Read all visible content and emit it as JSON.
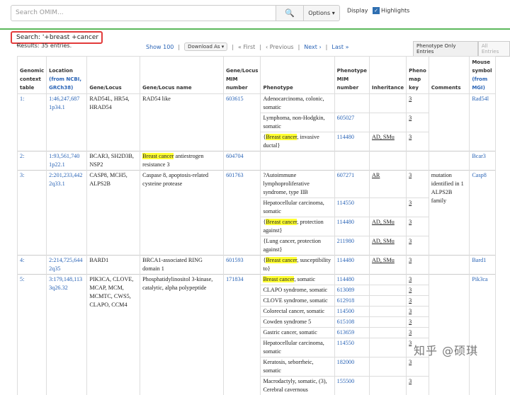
{
  "search": {
    "placeholder": "Search OMIM...",
    "options_label": "Options",
    "display_label": "Display",
    "highlights_label": "Highlights"
  },
  "query": {
    "text": "Search: '+breast +cancer '",
    "results": "Results: 35 entries."
  },
  "pager": {
    "show100": "Show 100",
    "download": "Download As",
    "first": "« First",
    "previous": "‹ Previous",
    "next": "Next ›",
    "last": "Last »"
  },
  "toggle": {
    "pheno_only": "Phenotype Only Entries",
    "all": "All Entries"
  },
  "headers": {
    "context": "Genomic context table",
    "location": "Location",
    "location_sub": "(from NCBI, GRCh38)",
    "gene": "Gene/Locus",
    "gene_name": "Gene/Locus name",
    "mim": "Gene/Locus MIM number",
    "phenotype": "Phenotype",
    "pheno_mim": "Phenotype MIM number",
    "inheritance": "Inheritance",
    "map_key": "Pheno map key",
    "comments": "Comments",
    "mouse": "Mouse symbol",
    "mouse_sub": "(from MGI)"
  },
  "rows": [
    {
      "n": "1:",
      "loc": "1:46,247,687",
      "band": "1p34.1",
      "gene": "RAD54L, HR54, HRAD54",
      "name": "RAD54 like",
      "mim": "603615",
      "pheno": [
        {
          "t": "Adenocarcinoma, colonic, somatic",
          "m": "",
          "i": "",
          "k": "3"
        },
        {
          "t": "Lymphoma, non-Hodgkin, somatic",
          "m": "605027",
          "i": "",
          "k": "3"
        },
        {
          "t": "{Breast cancer, invasive ductal}",
          "m": "114480",
          "i": "AD, SMu",
          "k": "3"
        }
      ],
      "comment": "",
      "mouse": "Rad54l"
    },
    {
      "n": "2:",
      "loc": "1:93,561,740",
      "band": "1p22.1",
      "gene": "BCAR3, SH2D3B, NSP2",
      "name": "Breast cancer antiestrogen resistance 3",
      "mim": "604704",
      "pheno": [],
      "comment": "",
      "mouse": "Bcar3"
    },
    {
      "n": "3:",
      "loc": "2:201,233,442",
      "band": "2q33.1",
      "gene": "CASP8, MCH5, ALPS2B",
      "name": "Caspase 8, apoptosis-related cysteine protease",
      "mim": "601763",
      "pheno": [
        {
          "t": "?Autoimmune lymphoproliferative syndrome, type IIB",
          "m": "607271",
          "i": "AR",
          "k": "3"
        },
        {
          "t": "Hepatocellular carcinoma, somatic",
          "m": "114550",
          "i": "",
          "k": "3"
        },
        {
          "t": "{Breast cancer, protection against}",
          "m": "114480",
          "i": "AD, SMu",
          "k": "3"
        },
        {
          "t": "{Lung cancer, protection against}",
          "m": "211980",
          "i": "AD, SMu",
          "k": "3"
        }
      ],
      "comment": "mutation identified in 1 ALPS2B family",
      "mouse": "Casp8"
    },
    {
      "n": "4:",
      "loc": "2:214,725,644",
      "band": "2q35",
      "gene": "BARD1",
      "name": "BRCA1-associated RING domain 1",
      "mim": "601593",
      "pheno": [
        {
          "t": "{Breast cancer, susceptibility to}",
          "m": "114480",
          "i": "AD, SMu",
          "k": "3"
        }
      ],
      "comment": "",
      "mouse": "Bard1"
    },
    {
      "n": "5:",
      "loc": "3:179,148,113",
      "band": "3q26.32",
      "gene": "PIK3CA, CLOVE, MCAP, MCM, MCMTC, CWS5, CLAPO, CCM4",
      "name": "Phosphatidylinositol 3-kinase, catalytic, alpha polypeptide",
      "mim": "171834",
      "pheno": [
        {
          "t": "Breast cancer, somatic",
          "m": "114480",
          "i": "",
          "k": "3"
        },
        {
          "t": "CLAPO syndrome, somatic",
          "m": "613089",
          "i": "",
          "k": "3"
        },
        {
          "t": "CLOVE syndrome, somatic",
          "m": "612918",
          "i": "",
          "k": "3"
        },
        {
          "t": "Colorectal cancer, somatic",
          "m": "114500",
          "i": "",
          "k": "3"
        },
        {
          "t": "Cowden syndrome 5",
          "m": "615108",
          "i": "",
          "k": "3"
        },
        {
          "t": "Gastric cancer, somatic",
          "m": "613659",
          "i": "",
          "k": "3"
        },
        {
          "t": "Hepatocellular carcinoma, somatic",
          "m": "114550",
          "i": "",
          "k": "3"
        },
        {
          "t": "Keratosis, seborrheic, somatic",
          "m": "182000",
          "i": "",
          "k": "3"
        },
        {
          "t": "Macrodactyly, somatic, (3), Cerebral cavernous",
          "m": "155500",
          "i": "",
          "k": "3"
        }
      ],
      "comment": "",
      "mouse": "Pik3ca"
    }
  ],
  "watermark": "知乎 @硕琪",
  "colors": {
    "accent_green": "#5cb85c",
    "link": "#2a64b6",
    "highlight": "#ffff33",
    "query_border": "#e23b3b"
  }
}
